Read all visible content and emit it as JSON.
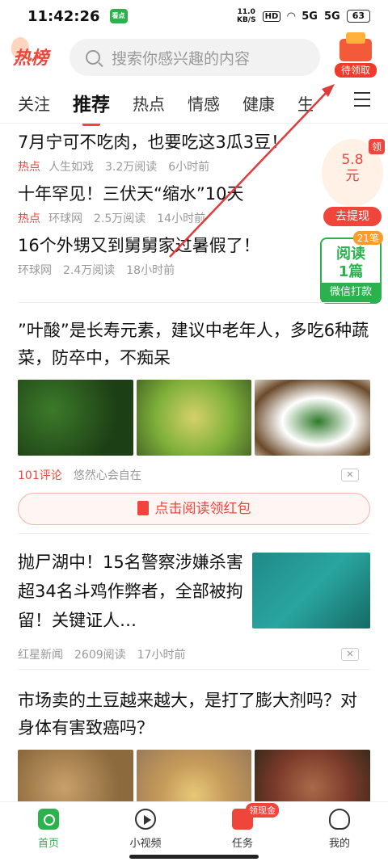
{
  "status": {
    "time": "11:42:26",
    "app_badge": "看点",
    "speed_top": "11.0",
    "speed_bottom": "KB/S",
    "hd": "HD",
    "signal1": "5G",
    "signal2": "5G",
    "battery": "63"
  },
  "header": {
    "logo": "热榜",
    "search_placeholder": "搜索你感兴趣的内容",
    "redpack_label": "待领取"
  },
  "tabs": [
    {
      "label": "关注",
      "active": false
    },
    {
      "label": "推荐",
      "active": true
    },
    {
      "label": "热点",
      "active": false
    },
    {
      "label": "情感",
      "active": false
    },
    {
      "label": "健康",
      "active": false
    },
    {
      "label": "生",
      "active": false
    }
  ],
  "hot_list": [
    {
      "title": "7月宁可不吃肉，也要吃这3瓜3豆！",
      "tag": "热点",
      "source": "人生如戏",
      "reads": "3.2万阅读",
      "time": "6小时前"
    },
    {
      "title": "十年罕见！三伏天“缩水”10天",
      "tag": "热点",
      "source": "环球网",
      "reads": "2.5万阅读",
      "time": "14小时前"
    },
    {
      "title": "16个外甥又到舅舅家过暑假了！",
      "tag": "",
      "source": "环球网",
      "reads": "2.4万阅读",
      "time": "18小时前"
    }
  ],
  "reward": {
    "coin_badge": "领",
    "coin_value": "5.8",
    "coin_unit": "元",
    "withdraw": "去提现",
    "read_badge": "21笔",
    "read_line1": "阅读",
    "read_line2": "1篇",
    "read_foot": "微信打款"
  },
  "articles": [
    {
      "title": "”叶酸”是长寿元素，建议中老年人，多吃6种蔬菜，防卒中，不痴呆",
      "comments": "101评论",
      "source": "悠然心会自在",
      "button": "点击阅读领红包"
    },
    {
      "title": "抛尸湖中！15名警察涉嫌杀害超34名斗鸡作弊者，全部被拘留！关键证人…",
      "source": "红星新闻",
      "reads": "2609阅读",
      "time": "17小时前"
    },
    {
      "title": "市场卖的土豆越来越大，是打了膨大剂吗？对身体有害致癌吗？"
    }
  ],
  "close_label": "✕",
  "bottom_nav": [
    {
      "label": "首页",
      "icon": "home-icon",
      "active": true
    },
    {
      "label": "小视频",
      "icon": "video-icon",
      "active": false
    },
    {
      "label": "任务",
      "icon": "task-icon",
      "active": false,
      "badge": "领现金"
    },
    {
      "label": "我的",
      "icon": "profile-icon",
      "active": false
    }
  ],
  "colors": {
    "accent": "#f0453a",
    "green": "#2bb24c",
    "annotation": "#e03a3a"
  }
}
